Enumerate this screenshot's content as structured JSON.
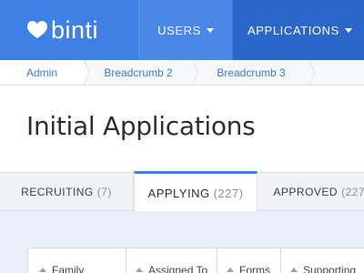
{
  "brand": {
    "name": "binti",
    "logo_icon": "heart-logo-icon"
  },
  "nav": {
    "users_label": "USERS",
    "applications_label": "APPLICATIONS",
    "caret_icon": "caret-down-icon"
  },
  "breadcrumb": [
    "Admin",
    "Breadcrumb 2",
    "Breadcrumb 3"
  ],
  "page": {
    "title": "Initial Applications"
  },
  "tabs": [
    {
      "label": "RECRUITING",
      "count": "(7)",
      "active": false
    },
    {
      "label": "APPLYING",
      "count": "(227)",
      "active": true
    },
    {
      "label": "APPROVED",
      "count": "(227)",
      "active": false
    }
  ],
  "table": {
    "columns": [
      "Family",
      "Assigned To",
      "Forms",
      "Supporting"
    ],
    "sort_icon": "sort-up-icon"
  },
  "colors": {
    "primary": "#3f80e4",
    "primary_dark": "#2b67c8",
    "content_bg": "#e8effb",
    "link": "#3a7bd5"
  }
}
